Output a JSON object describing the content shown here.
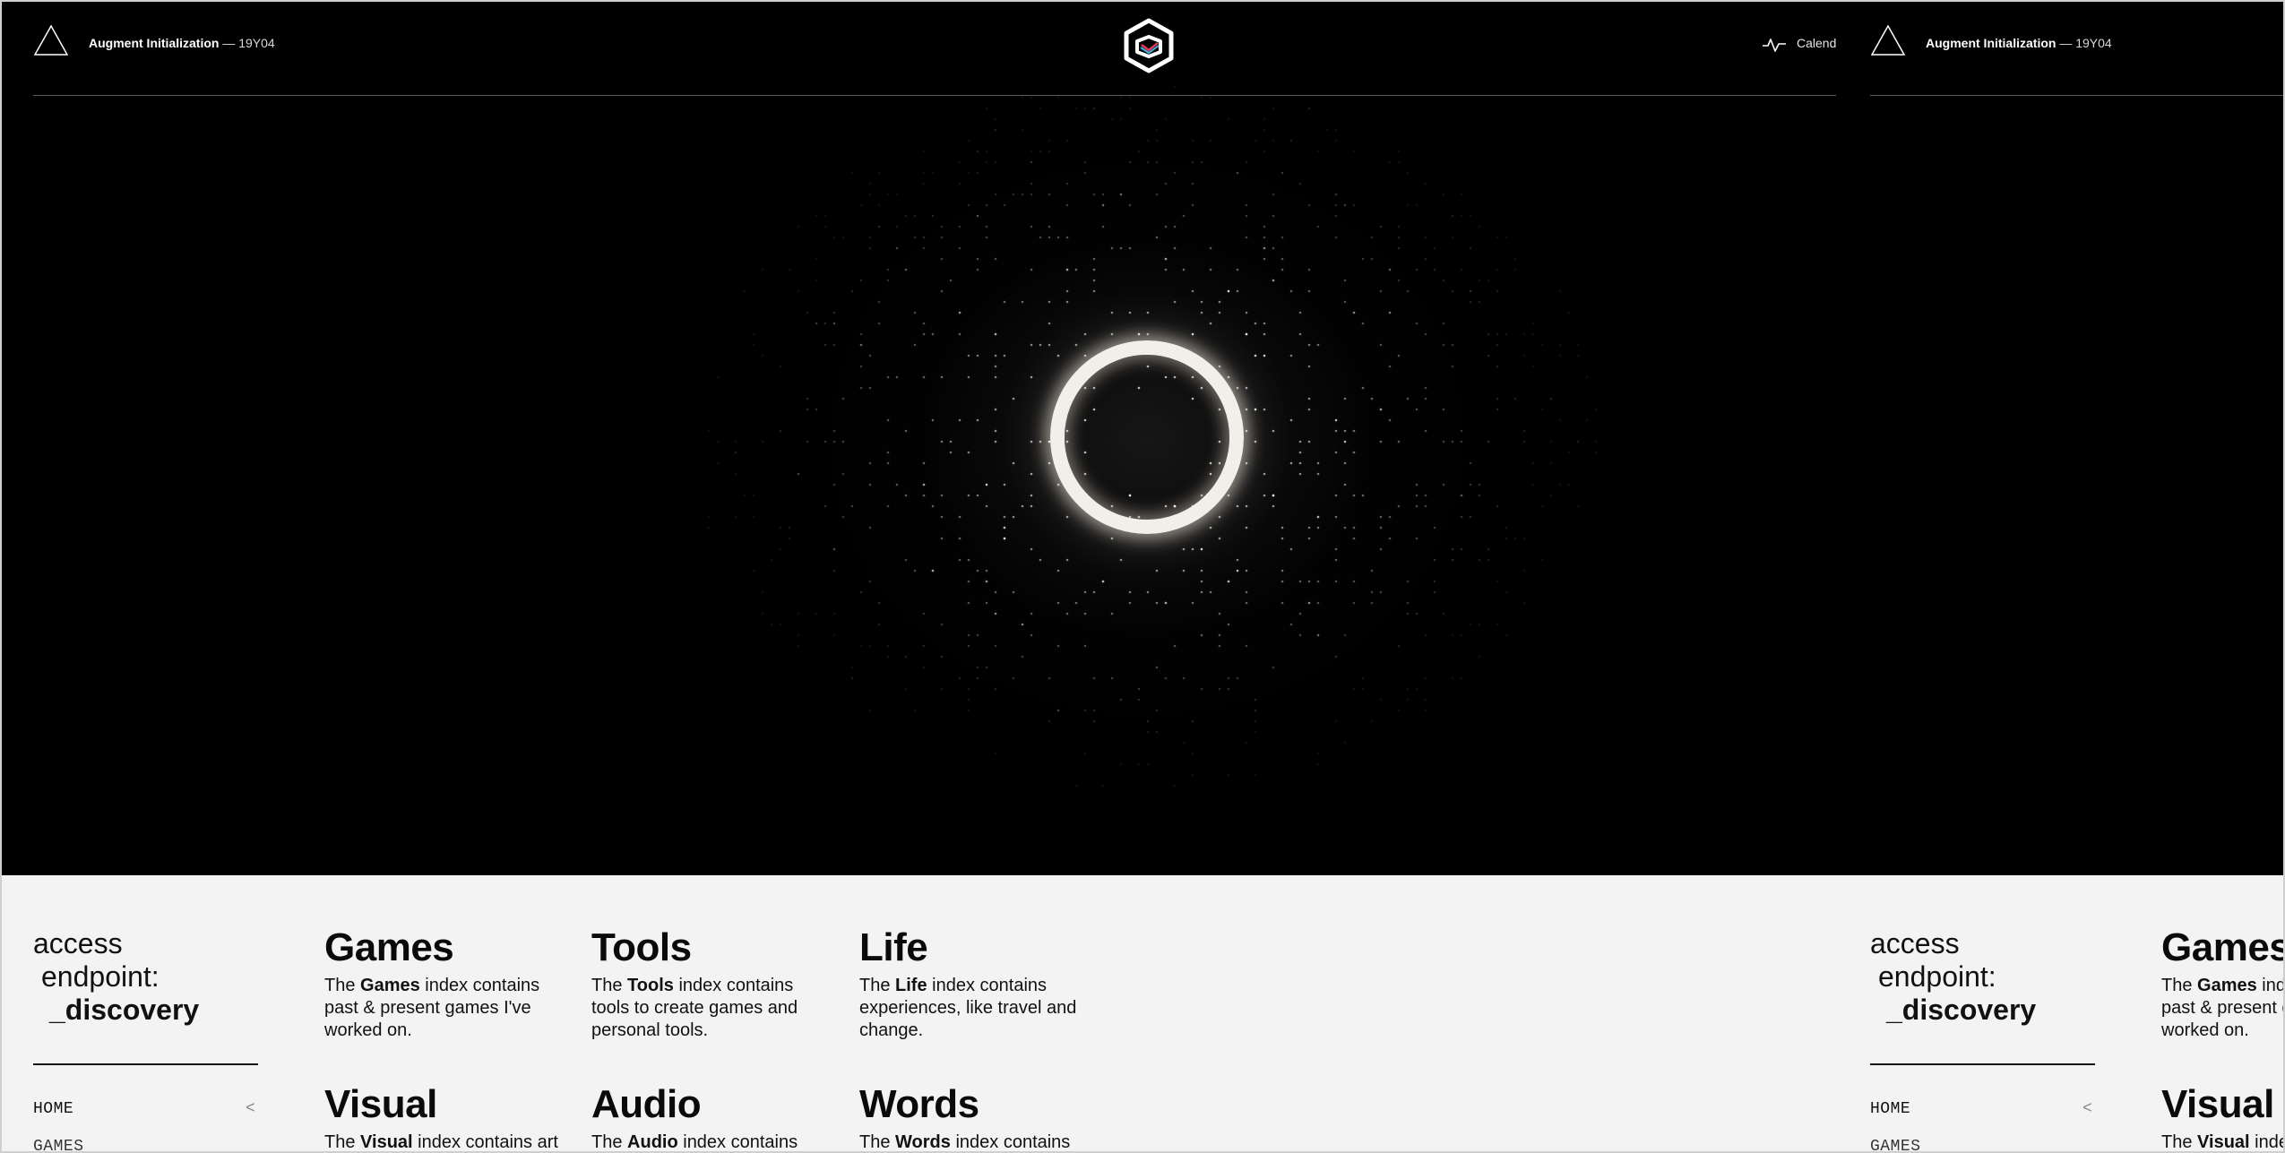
{
  "header": {
    "brand_title": "Augment Initialization",
    "brand_separator": " — ",
    "brand_code": "19Y04",
    "calendar_link": "Calendar"
  },
  "icons": {
    "triangle": "triangle-outline-icon",
    "logo": "hexagon-logo-icon",
    "activity": "activity-pulse-icon"
  },
  "colors": {
    "hero_bg": "#000000",
    "panel_bg": "#f3f3f3",
    "ring": "#f2efea",
    "text_dark": "#0a0a0a"
  },
  "sidebar": {
    "access_line1": "access",
    "access_line2": "endpoint:",
    "access_line3": "_discovery",
    "nav_home": "HOME",
    "nav_collapse_glyph": "<",
    "nav_games": "GAMES"
  },
  "indexes": [
    {
      "title": "Games",
      "pre": "The ",
      "strong": "Games",
      "post": " index contains past & present games I've worked on."
    },
    {
      "title": "Tools",
      "pre": "The ",
      "strong": "Tools",
      "post": " index contains tools to create games and personal tools."
    },
    {
      "title": "Life",
      "pre": "The ",
      "strong": "Life",
      "post": " index contains experiences, like travel and change."
    },
    {
      "title": "Visual",
      "pre": "The ",
      "strong": "Visual",
      "post": " index contains art"
    },
    {
      "title": "Audio",
      "pre": "The ",
      "strong": "Audio",
      "post": " index contains"
    },
    {
      "title": "Words",
      "pre": "The ",
      "strong": "Words",
      "post": " index contains"
    }
  ]
}
